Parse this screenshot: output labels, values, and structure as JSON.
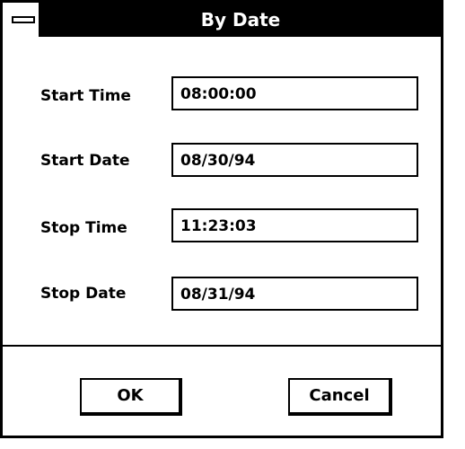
{
  "window": {
    "title": "By Date"
  },
  "fields": [
    {
      "label": "Start Time",
      "value": "08:00:00"
    },
    {
      "label": "Start Date",
      "value": "08/30/94"
    },
    {
      "label": "Stop Time",
      "value": "11:23:03"
    },
    {
      "label": "Stop Date",
      "value": "08/31/94"
    }
  ],
  "buttons": {
    "ok": "OK",
    "cancel": "Cancel"
  },
  "icons": {
    "system_menu": "system-menu-icon"
  }
}
